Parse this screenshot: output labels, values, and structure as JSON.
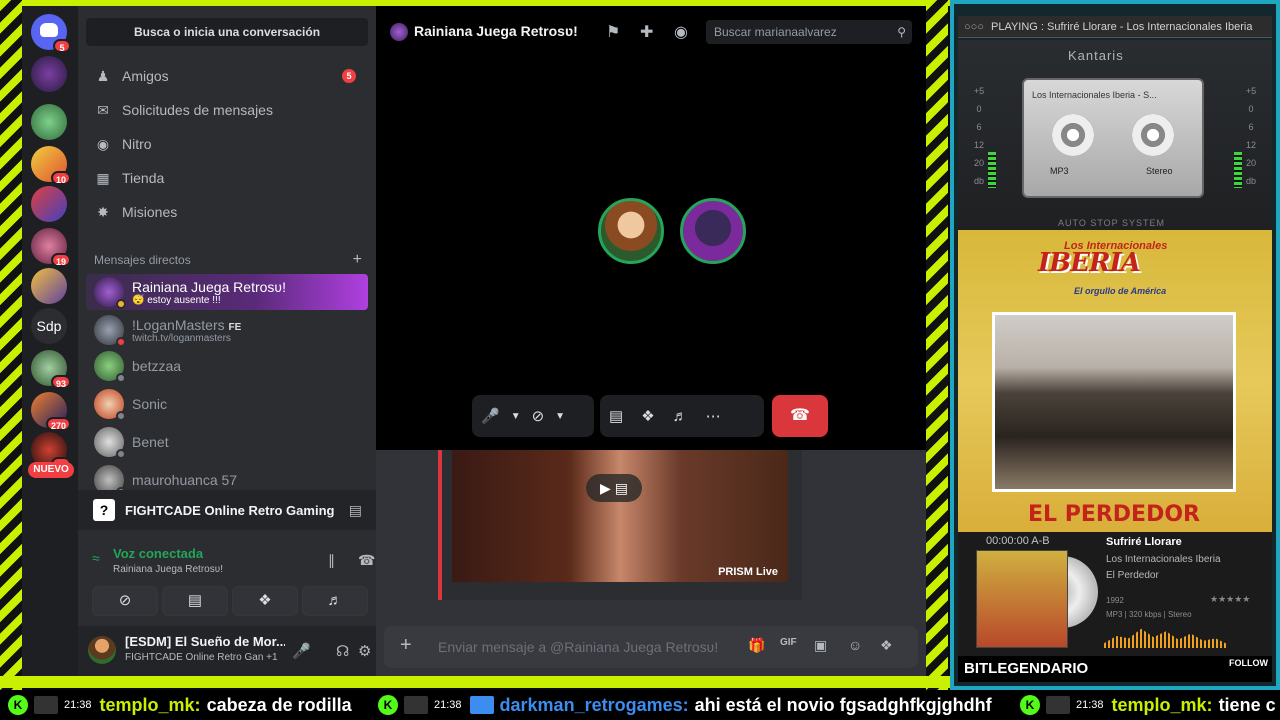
{
  "discord": {
    "search_label": "Busca o inicia una conversación",
    "nav": [
      {
        "label": "Amigos",
        "badge": "5",
        "icon": "friends-icon"
      },
      {
        "label": "Solicitudes de mensajes",
        "icon": "mail-icon"
      },
      {
        "label": "Nitro",
        "icon": "nitro-icon"
      },
      {
        "label": "Tienda",
        "icon": "shop-icon"
      },
      {
        "label": "Misiones",
        "icon": "quests-icon"
      }
    ],
    "servers": [
      {
        "badge": "5"
      },
      {
        "badge": ""
      },
      {
        "badge": ""
      },
      {
        "badge": "10"
      },
      {
        "badge": ""
      },
      {
        "badge": "19"
      },
      {
        "badge": ""
      },
      {
        "label": "Sdp"
      },
      {
        "badge": "93"
      },
      {
        "badge": "270"
      },
      {
        "badge": "40"
      }
    ],
    "new_label": "NUEVO",
    "dm_header": "Mensajes directos",
    "dms": [
      {
        "name": "Rainiana Juega Retrosʋ!",
        "sub": "😴 estoy ausente !!!"
      },
      {
        "name": "!LoganMasters",
        "tag": "FE",
        "sub": "twitch.tv/loganmasters"
      },
      {
        "name": "betzzaa"
      },
      {
        "name": "Sonic"
      },
      {
        "name": "Benet"
      },
      {
        "name": "maurohuanca 57"
      }
    ],
    "activity": "FIGHTCADE Online Retro Gaming",
    "voice": {
      "status": "Voz conectada",
      "channel": "Rainiana Juega Retrosʋ!"
    },
    "user": {
      "name": "[ESDM] El Sueño de Mor...",
      "status": "FIGHTCADE Online Retro Gan +1"
    },
    "call": {
      "title": "Rainiana Juega Retrosʋ!",
      "search_placeholder": "Buscar marianaalvarez",
      "message_placeholder": "Enviar mensaje a @Rainiana Juega Retrosʋ!",
      "stream_watermark": "PRISM Live"
    }
  },
  "player": {
    "now_playing": "PLAYING : Sufriré Llorare - Los Internacionales Iberia",
    "skin": "Kantaris",
    "cassette_label": "Los Internacionales Iberia - S...",
    "cassette_format": "MP3",
    "cassette_mode": "Stereo",
    "vu_scale": [
      "+5",
      "0",
      "6",
      "12",
      "20",
      "db"
    ],
    "autostop": "AUTO STOP SYSTEM",
    "cover_brand_top": "Los Internacionales",
    "cover_brand": "IBERIA",
    "cover_tagline": "El orgullo de América",
    "cover_album": "EL PERDEDOR",
    "time": "00:00:00 A-B",
    "track": "Sufriré Llorare",
    "artist": "Los Internacionales Iberia",
    "album": "El Perdedor",
    "year": "1992",
    "tech": "MP3  |  320 kbps  | Stereo",
    "rating": "★★★★★",
    "brand": "BITLEGENDARIO",
    "follow": "FOLLOW"
  },
  "ticker": [
    {
      "time": "21:38",
      "user": "templo_mk:",
      "message": "cabeza de rodilla",
      "color": "#c8f000"
    },
    {
      "time": "21:38",
      "user": "darkman_retrogames:",
      "message": "ahi está el novio fgsadghfkgjghdhf",
      "color": "#3b8df0"
    },
    {
      "time": "21:38",
      "user": "templo_mk:",
      "message": "tiene c",
      "color": "#c8f000"
    }
  ]
}
